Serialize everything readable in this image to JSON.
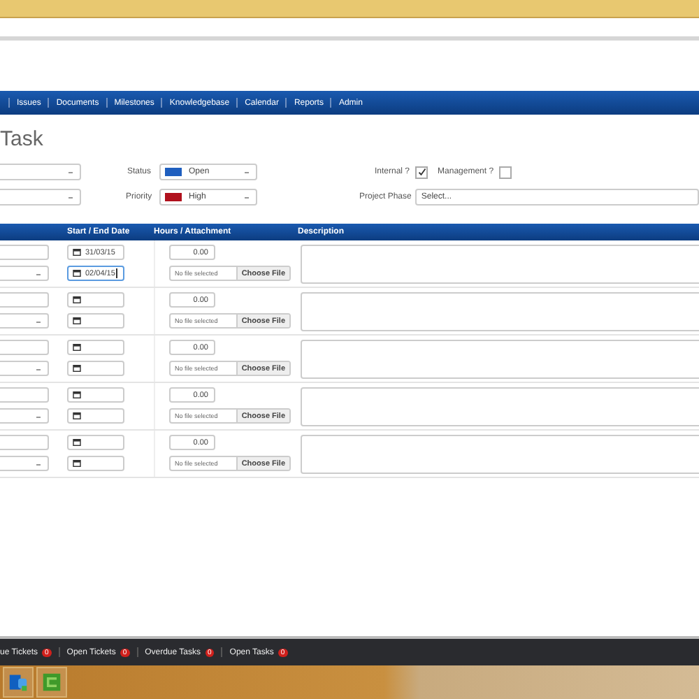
{
  "nav": {
    "items": [
      "Issues",
      "Documents",
      "Milestones",
      "Knowledgebase",
      "Calendar",
      "Reports",
      "Admin"
    ]
  },
  "page_title": "Task",
  "fields": [
    {
      "label": "Status",
      "value": "Open",
      "color": "#1f5fbf"
    },
    {
      "label": "Priority",
      "value": "High",
      "color": "#b0101c"
    }
  ],
  "flags": [
    {
      "label": "Internal ?",
      "checked": true
    },
    {
      "label": "Management ?",
      "checked": false
    }
  ],
  "project_phase": {
    "label": "Project Phase",
    "value": "Select..."
  },
  "table": {
    "columns": [
      "Start / End Date",
      "Hours / Attachment",
      "Description"
    ],
    "rows": [
      {
        "start": "31/03/15",
        "end": "02/04/15",
        "end_focused": true,
        "hours": "0.00",
        "file_status": "No file selected",
        "file_button": "Choose File"
      },
      {
        "end_focused": false,
        "hours": "0.00",
        "file_status": "No file selected",
        "file_button": "Choose File"
      },
      {
        "end_focused": false,
        "hours": "0.00",
        "file_status": "No file selected",
        "file_button": "Choose File"
      },
      {
        "end_focused": false,
        "hours": "0.00",
        "file_status": "No file selected",
        "file_button": "Choose File"
      },
      {
        "end_focused": false,
        "hours": "0.00",
        "file_status": "No file selected",
        "file_button": "Choose File"
      }
    ]
  },
  "status_bar": [
    {
      "label": "ue Tickets",
      "count": "0"
    },
    {
      "label": "Open Tickets",
      "count": "0"
    },
    {
      "label": "Overdue Tasks",
      "count": "0"
    },
    {
      "label": "Open Tasks",
      "count": "0"
    }
  ]
}
